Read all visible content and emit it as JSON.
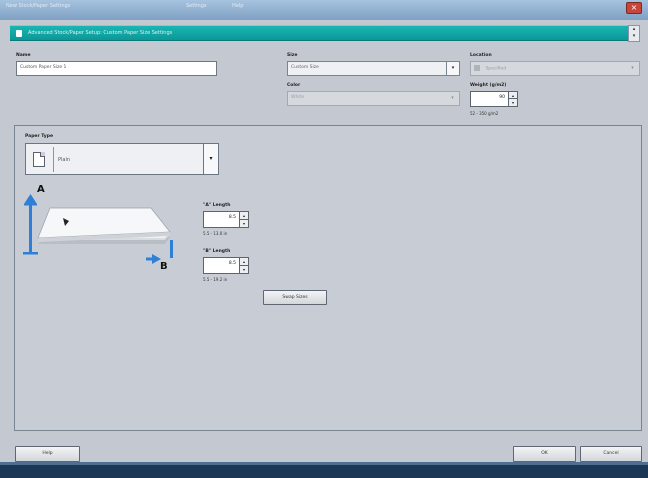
{
  "window": {
    "title_segments": [
      "New Stock/Paper Settings",
      "Settings",
      "Help"
    ]
  },
  "header": {
    "title": "Advanced Stock/Paper Setup: Custom Paper Size Settings"
  },
  "form": {
    "name_label": "Name",
    "name_value": "Custom Paper Size 1",
    "size_label": "Size",
    "size_value": "Custom Size",
    "color_label": "Color",
    "color_value": "White",
    "location_label": "Location",
    "location_value": "Specified",
    "weight_label": "Weight (g/m2)",
    "weight_value": "90",
    "weight_hint": "52 - 350 g/m2"
  },
  "paper_type": {
    "label": "Paper Type",
    "value": "Plain"
  },
  "dimensions": {
    "a_label": "\"A\" Length",
    "a_value": "8.5",
    "a_hint": "5.5 - 13.0 in",
    "b_label": "\"B\" Length",
    "b_value": "8.5",
    "b_hint": "5.5 - 19.2 in",
    "letter_a": "A",
    "letter_b": "B",
    "swap_label": "Swap Sizes"
  },
  "footer": {
    "help_label": "Help",
    "ok_label": "OK",
    "cancel_label": "Cancel"
  },
  "colors": {
    "header_teal": "#12a9a8",
    "window_bg": "#c4c8d0",
    "arrow_blue": "#2f7fd6"
  }
}
